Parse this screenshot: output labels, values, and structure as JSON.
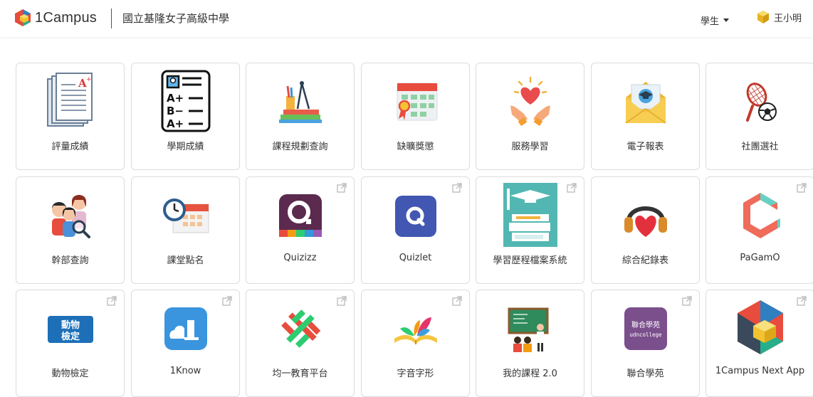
{
  "header": {
    "brand": "1Campus",
    "school": "國立基隆女子高級中學",
    "role": "學生",
    "user": "王小明"
  },
  "apps": [
    {
      "label": "評量成績",
      "icon": "report-pages-icon",
      "external": false
    },
    {
      "label": "學期成績",
      "icon": "grade-sheet-icon",
      "external": false
    },
    {
      "label": "課程規劃查詢",
      "icon": "books-pencils-icon",
      "external": false
    },
    {
      "label": "缺曠獎懲",
      "icon": "calendar-medal-icon",
      "external": false
    },
    {
      "label": "服務學習",
      "icon": "hands-heart-icon",
      "external": false
    },
    {
      "label": "電子報表",
      "icon": "envelope-mortarboard-icon",
      "external": false
    },
    {
      "label": "社團選社",
      "icon": "racket-ball-icon",
      "external": false
    },
    {
      "label": "幹部查詢",
      "icon": "people-search-icon",
      "external": false
    },
    {
      "label": "課堂點名",
      "icon": "clock-calendar-icon",
      "external": false
    },
    {
      "label": "Quizizz",
      "icon": "quizizz-logo-icon",
      "external": true
    },
    {
      "label": "Quizlet",
      "icon": "quizlet-logo-icon",
      "external": true
    },
    {
      "label": "學習歷程檔案系統",
      "icon": "portfolio-books-icon",
      "external": true
    },
    {
      "label": "綜合紀錄表",
      "icon": "headphones-heart-icon",
      "external": false
    },
    {
      "label": "PaGamO",
      "icon": "pagamo-logo-icon",
      "external": true
    },
    {
      "label": "動物檢定",
      "icon": "animal-test-logo-icon",
      "external": true
    },
    {
      "label": "1Know",
      "icon": "1know-logo-icon",
      "external": true
    },
    {
      "label": "均一教育平台",
      "icon": "junyi-logo-icon",
      "external": true
    },
    {
      "label": "字音字形",
      "icon": "open-book-leaves-icon",
      "external": true
    },
    {
      "label": "我的課程 2.0",
      "icon": "classroom-teacher-icon",
      "external": false
    },
    {
      "label": "聯合學苑",
      "icon": "udncollege-logo-icon",
      "external": true
    },
    {
      "label": "1Campus Next App",
      "icon": "1campus-next-logo-icon",
      "external": true
    }
  ],
  "app_icon_texts": {
    "animal_test": "動物檢定",
    "udn_title": "聯合學苑",
    "udn_sub": "udncollege",
    "grades": [
      "A+",
      "B−",
      "A+"
    ]
  }
}
